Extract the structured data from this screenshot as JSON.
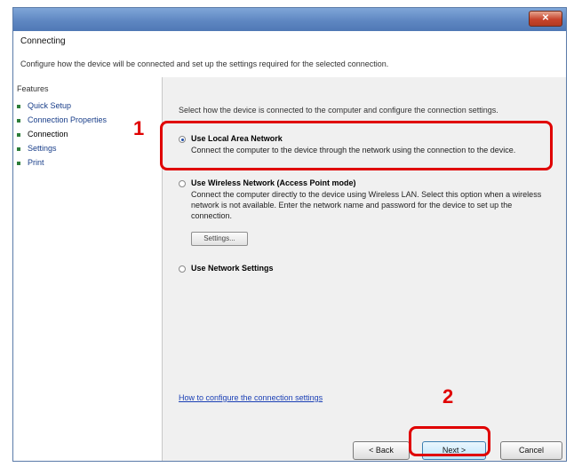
{
  "window": {
    "title": "",
    "close_glyph": "✕",
    "header_title": "Connecting",
    "header_desc": "Configure how the device will be connected and set up the settings required for the selected connection."
  },
  "sidebar": {
    "heading": "Features",
    "items": [
      {
        "label": "Quick Setup",
        "selected": false
      },
      {
        "label": "Connection Properties",
        "selected": false
      },
      {
        "label": "Connection",
        "selected": true
      },
      {
        "label": "Settings",
        "selected": false
      },
      {
        "label": "Print",
        "selected": false
      }
    ]
  },
  "content": {
    "intro": "Select how the device is connected to the computer and configure the connection settings.",
    "options": [
      {
        "title": "Use Local Area Network",
        "desc": "Connect the computer to the device through the network using the connection to the device.",
        "checked": true
      },
      {
        "title": "Use Wireless Network (Access Point mode)",
        "desc": "Connect the computer directly to the device using Wireless LAN. Select this option when a wireless network is not available. Enter the network name and password for the device to set up the connection.",
        "checked": false,
        "button_label": "Settings..."
      },
      {
        "title": "Use Network Settings",
        "desc": "",
        "checked": false
      }
    ],
    "help_link": "How to configure the connection settings"
  },
  "buttons": {
    "back": "< Back",
    "next": "Next >",
    "cancel": "Cancel"
  },
  "annotations": {
    "step1": "1",
    "step2": "2"
  },
  "colors": {
    "callout": "#e00000",
    "titlebar": "#5f87c2",
    "link": "#1a3fb5"
  }
}
